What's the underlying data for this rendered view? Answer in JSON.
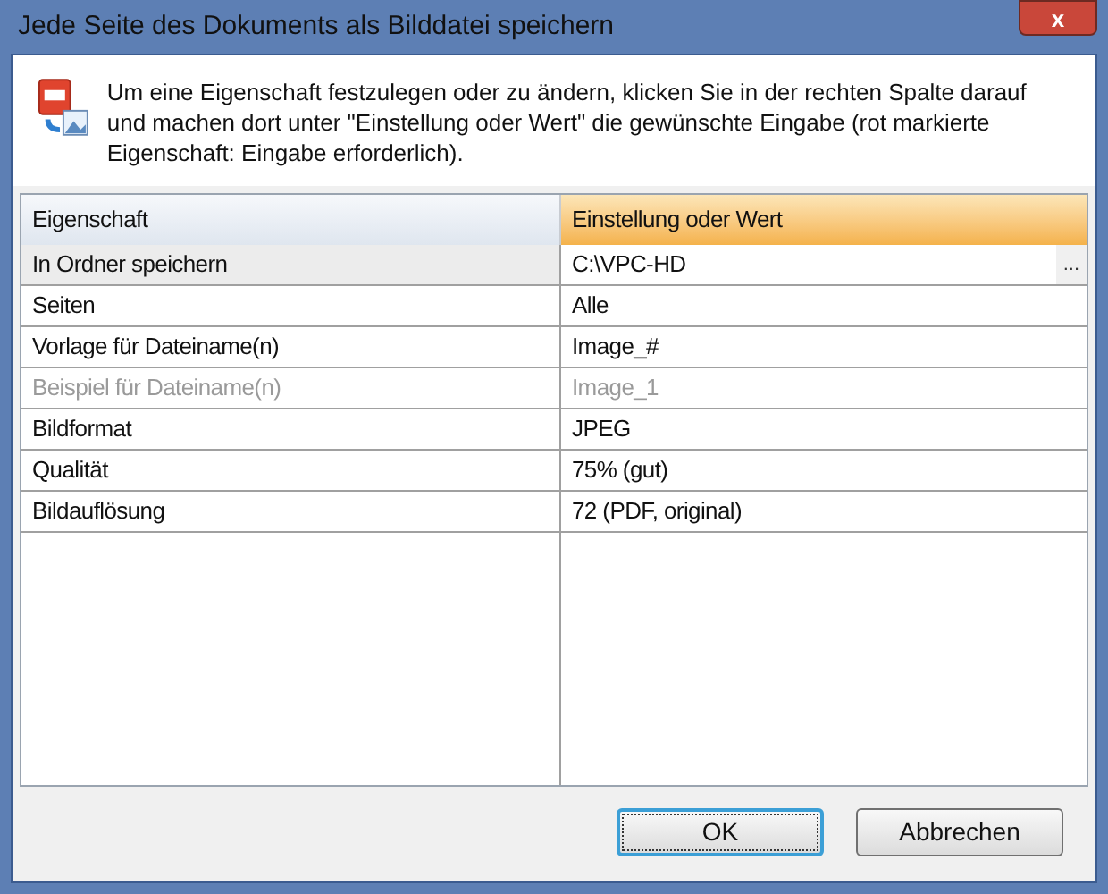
{
  "window": {
    "title": "Jede Seite des Dokuments als Bilddatei speichern",
    "close_button": "x"
  },
  "info": {
    "text": "Um eine Eigenschaft festzulegen oder zu ändern, klicken Sie in der rechten Spalte darauf und machen dort unter \"Einstellung oder Wert\" die gewünschte Eingabe (rot markierte Eigenschaft: Eingabe erforderlich)."
  },
  "table": {
    "columns": [
      {
        "label": "Eigenschaft",
        "highlighted": false
      },
      {
        "label": "Einstellung oder Wert",
        "highlighted": true
      }
    ],
    "rows": [
      {
        "property": "In Ordner speichern",
        "value": "C:\\VPC-HD",
        "browse_button": "...",
        "selected": true,
        "disabled": false
      },
      {
        "property": "Seiten",
        "value": "Alle",
        "selected": false,
        "disabled": false
      },
      {
        "property": "Vorlage für Dateiname(n)",
        "value": "Image_#",
        "selected": false,
        "disabled": false
      },
      {
        "property": "Beispiel für Dateiname(n)",
        "value": "Image_1",
        "selected": false,
        "disabled": true
      },
      {
        "property": "Bildformat",
        "value": "JPEG",
        "selected": false,
        "disabled": false
      },
      {
        "property": "Qualität",
        "value": "75% (gut)",
        "selected": false,
        "disabled": false
      },
      {
        "property": "Bildauflösung",
        "value": "72 (PDF, original)",
        "selected": false,
        "disabled": false
      }
    ]
  },
  "buttons": [
    {
      "label": "OK",
      "default": true
    },
    {
      "label": "Abbrechen",
      "default": false
    }
  ]
}
